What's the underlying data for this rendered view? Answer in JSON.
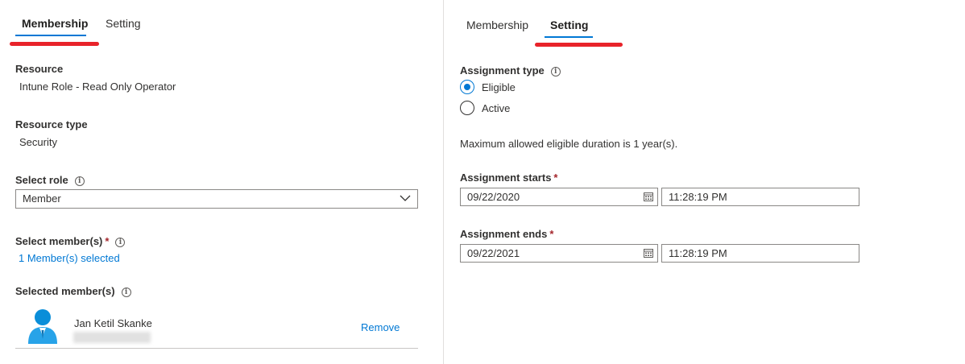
{
  "left": {
    "tabs": [
      {
        "label": "Membership",
        "active": true
      },
      {
        "label": "Setting",
        "active": false
      }
    ],
    "resource_label": "Resource",
    "resource_value": "Intune Role - Read Only Operator",
    "resource_type_label": "Resource type",
    "resource_type_value": "Security",
    "select_role_label": "Select role",
    "select_role_value": "Member",
    "select_members_label": "Select member(s)",
    "select_members_link": "1 Member(s) selected",
    "selected_members_label": "Selected member(s)",
    "members": [
      {
        "name": "Jan Ketil Skanke",
        "remove_label": "Remove"
      }
    ]
  },
  "right": {
    "tabs": [
      {
        "label": "Membership",
        "active": false
      },
      {
        "label": "Setting",
        "active": true
      }
    ],
    "assignment_type_label": "Assignment type",
    "options": [
      {
        "label": "Eligible",
        "checked": true
      },
      {
        "label": "Active",
        "checked": false
      }
    ],
    "max_duration_text": "Maximum allowed eligible duration is 1 year(s).",
    "starts_label": "Assignment starts",
    "starts_date": "09/22/2020",
    "starts_time": "11:28:19 PM",
    "ends_label": "Assignment ends",
    "ends_date": "09/22/2021",
    "ends_time": "11:28:19 PM"
  },
  "colors": {
    "accent": "#0078d4",
    "annotation_red": "#e8232a",
    "required": "#a4262c"
  }
}
